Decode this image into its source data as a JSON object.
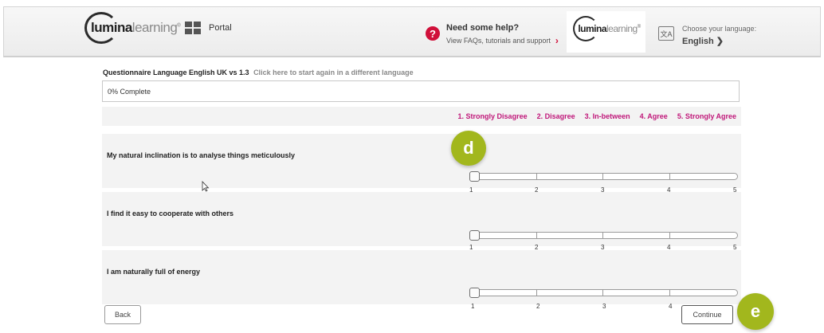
{
  "header": {
    "brand_bold": "lumina",
    "brand_light": "learning",
    "brand_mark": "®",
    "portal_label": "Portal",
    "help_title": "Need some help?",
    "help_subtitle": "View FAQs, tutorials and support",
    "help_icon": "?",
    "chevron": "›",
    "language_label": "Choose your language:",
    "language_value": "English ❯",
    "lang_icon": "文A"
  },
  "questionnaire": {
    "language_text": "Questionnaire Language English UK vs 1.3",
    "restart_link": "Click here to start again in a different language",
    "progress_text": "0% Complete",
    "scale_labels": [
      "1. Strongly Disagree",
      "2. Disagree",
      "3. In-between",
      "4. Agree",
      "5. Strongly Agree"
    ],
    "questions": [
      {
        "text": "My natural inclination is to analyse things meticulously",
        "value": 1
      },
      {
        "text": "I find it easy to cooperate with others",
        "value": 1
      },
      {
        "text": "I am naturally full of energy",
        "value": 1
      }
    ],
    "scale_numbers": [
      "1",
      "2",
      "3",
      "4",
      "5"
    ]
  },
  "buttons": {
    "back": "Back",
    "continue": "Continue"
  },
  "annotations": {
    "d": "d",
    "e": "e"
  },
  "colors": {
    "scale_label": "#c0187a",
    "help_accent": "#d0103a",
    "badge": "#a2b71d"
  }
}
